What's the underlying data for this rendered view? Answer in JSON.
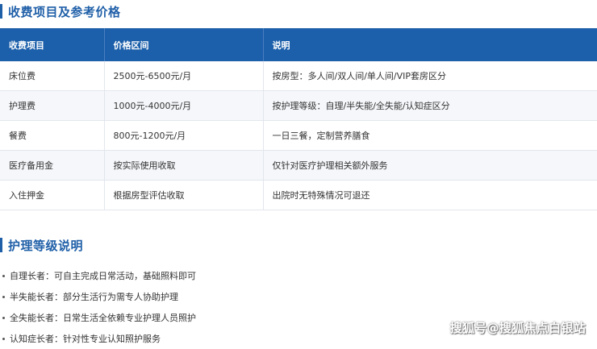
{
  "section1": {
    "title": "收费项目及参考价格"
  },
  "table": {
    "headers": [
      "收费项目",
      "价格区间",
      "说明"
    ],
    "rows": [
      [
        "床位费",
        "2500元-6500元/月",
        "按房型：多人间/双人间/单人间/VIP套房区分"
      ],
      [
        "护理费",
        "1000元-4000元/月",
        "按护理等级：自理/半失能/全失能/认知症区分"
      ],
      [
        "餐费",
        "800元-1200元/月",
        "一日三餐，定制营养膳食"
      ],
      [
        "医疗备用金",
        "按实际使用收取",
        "仅针对医疗护理相关额外服务"
      ],
      [
        "入住押金",
        "根据房型评估收取",
        "出院时无特殊情况可退还"
      ]
    ]
  },
  "section2": {
    "title": "护理等级说明"
  },
  "levels": [
    "自理长者：可自主完成日常活动，基础照料即可",
    "半失能长者：部分生活行为需专人协助护理",
    "全失能长者：日常生活全依赖专业护理人员照护",
    "认知症长者：针对性专业认知照护服务"
  ],
  "watermark": "搜狐号@搜狐焦点白银站"
}
